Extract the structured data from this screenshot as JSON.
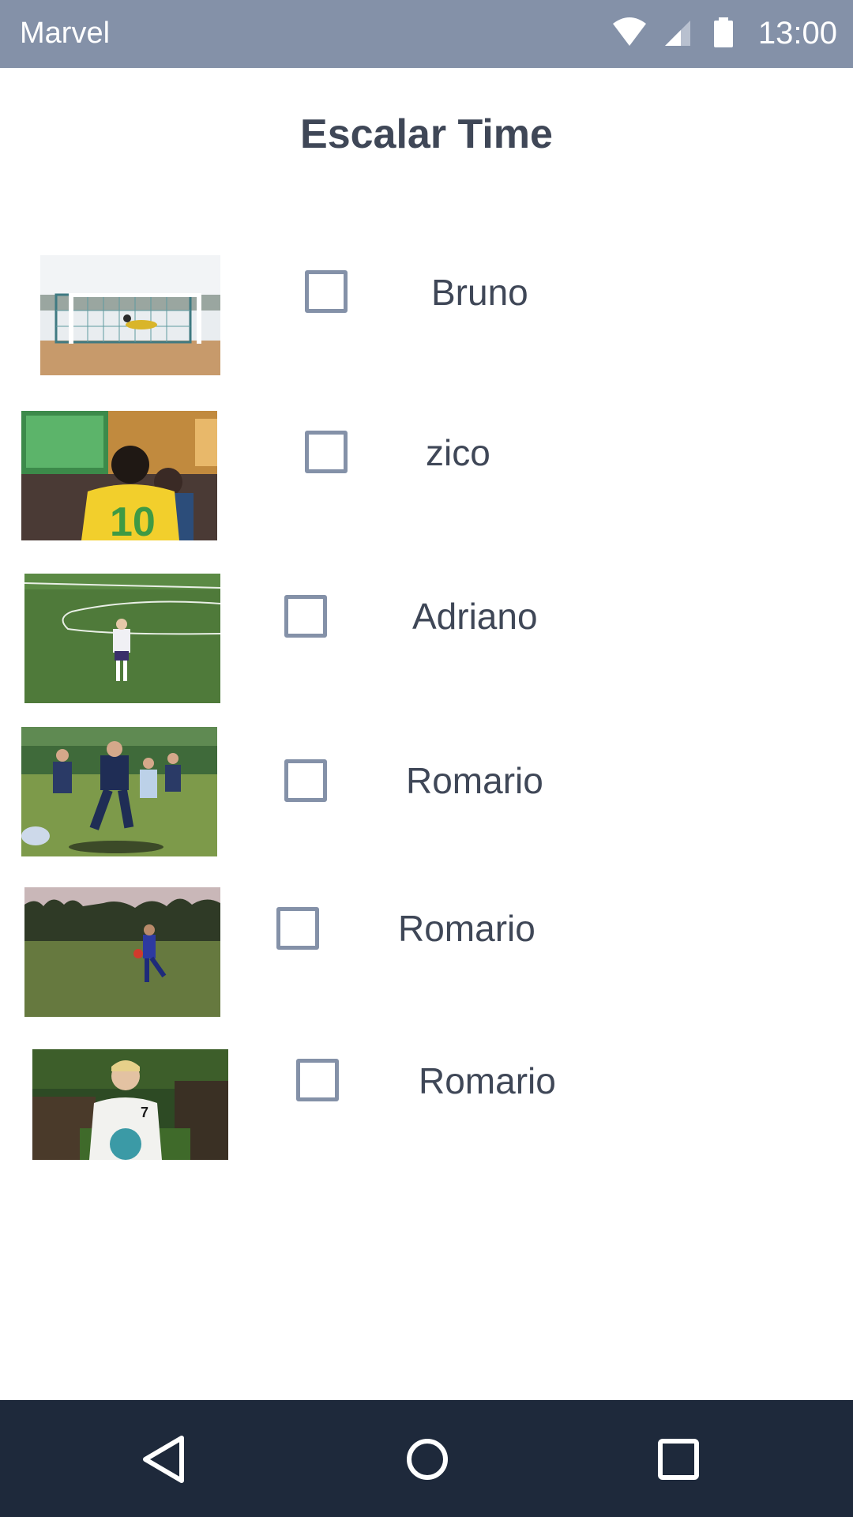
{
  "status_bar": {
    "app_name": "Marvel",
    "time": "13:00",
    "icons": [
      "wifi-icon",
      "cell-signal-icon",
      "battery-icon"
    ]
  },
  "page": {
    "title": "Escalar Time"
  },
  "players": [
    {
      "name": "Bruno",
      "checked": false,
      "photo": "goalkeeper-diving-photo"
    },
    {
      "name": "zico",
      "checked": false,
      "photo": "fan-watching-tv-photo"
    },
    {
      "name": "Adriano",
      "checked": false,
      "photo": "player-on-pitch-photo"
    },
    {
      "name": "Romario",
      "checked": false,
      "photo": "rugby-players-photo"
    },
    {
      "name": "Romario",
      "checked": false,
      "photo": "player-kicking-ball-photo"
    },
    {
      "name": "Romario",
      "checked": false,
      "photo": "player-holding-ball-photo"
    }
  ],
  "nav_bar": {
    "buttons": [
      "back-icon",
      "home-icon",
      "recents-icon"
    ]
  },
  "colors": {
    "status_bar": "#8491a8",
    "text": "#3f4757",
    "checkbox": "#8491a8",
    "nav_bar": "#1e293b"
  }
}
